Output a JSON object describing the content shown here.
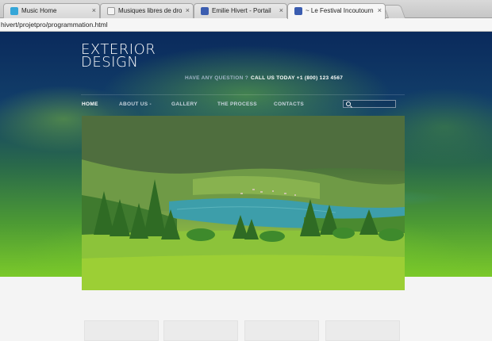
{
  "browser": {
    "tabs": [
      {
        "label": "Music Home",
        "favicon_color": "#35a6d8",
        "active": false
      },
      {
        "label": "Musiques libres de droits gr",
        "favicon_color": "#dcdcdc",
        "active": false
      },
      {
        "label": "Emilie Hivert - Portail",
        "favicon_color": "#3b5db0",
        "active": false
      },
      {
        "label": "~ Le Festival Incoutournable",
        "favicon_color": "#3b5db0",
        "active": true
      }
    ],
    "close_glyph": "×",
    "address": "hivert/projetpro/programmation.html"
  },
  "site": {
    "logo_line1": "EXTERIOR",
    "logo_line2": "DESIGN",
    "call_prefix": "HAVE ANY QUESTION ?",
    "call_strong": "CALL US TODAY +1 (800) 123 4567",
    "nav": [
      {
        "label": "HOME",
        "active": true
      },
      {
        "label": "ABOUT US -",
        "active": false
      },
      {
        "label": "GALLERY",
        "active": false
      },
      {
        "label": "THE PROCESS",
        "active": false
      },
      {
        "label": "CONTACTS",
        "active": false
      }
    ],
    "search_icon": "search-icon"
  },
  "colors": {
    "header_dark": "#0a2a5c",
    "grass": "#8fc23a",
    "lake": "#3a9aa5",
    "page_bg": "#f4f4f4"
  }
}
